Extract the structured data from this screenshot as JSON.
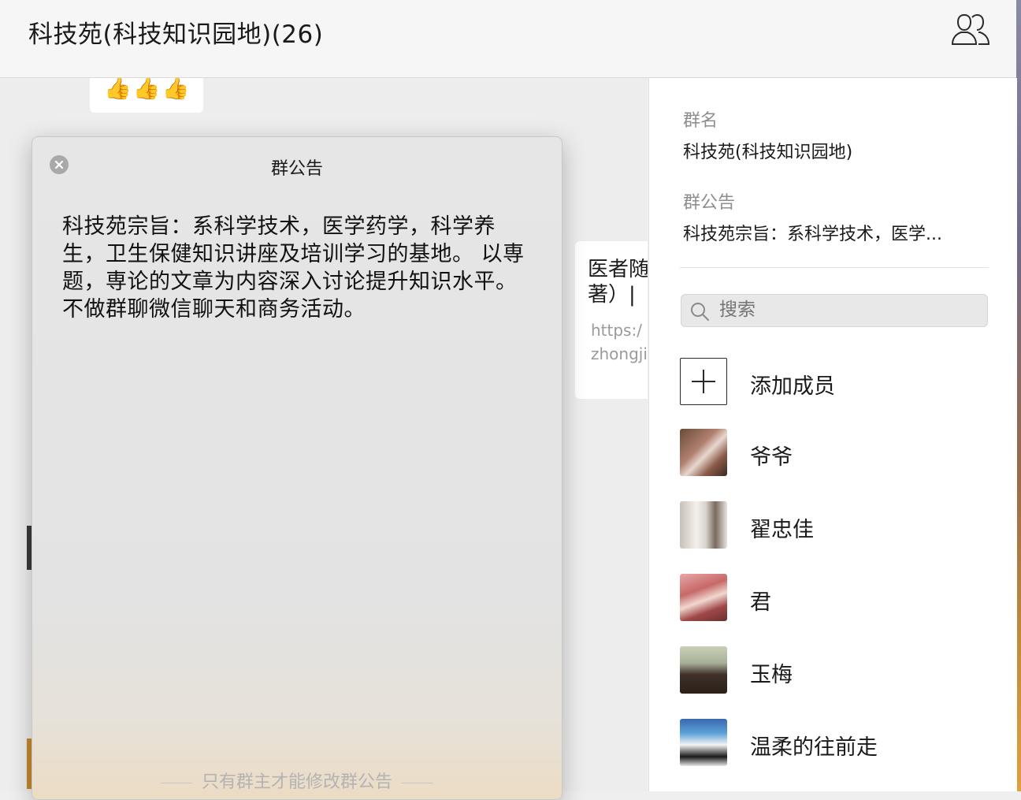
{
  "header": {
    "title": "科技苑(科技知识园地)(26)",
    "members_icon": "group-members-icon"
  },
  "chat": {
    "emoji_bubble": "👍👍👍",
    "link_card_title": "医者随\n著）|",
    "link_card_url": "https:/\nzhongji"
  },
  "announcement_modal": {
    "title": "群公告",
    "body": "科技苑宗旨：系科学技术，医学药学，科学养生，卫生保健知识讲座及培训学习的基地。 以専题，専论的文章为内容深入讨论提升知识水平。不做群聊微信聊天和商务活动。",
    "footer": "只有群主才能修改群公告",
    "close_icon": "close-icon"
  },
  "info_panel": {
    "group_name_label": "群名",
    "group_name": "科技苑(科技知识园地)",
    "announcement_label": "群公告",
    "announcement_preview": "科技苑宗旨：系科学技术，医学...",
    "search_placeholder": "搜索",
    "add_member_label": "添加成员",
    "members": [
      {
        "name": "爷爷"
      },
      {
        "name": "翟忠佳"
      },
      {
        "name": "君"
      },
      {
        "name": "玉梅"
      },
      {
        "name": "温柔的往前走"
      }
    ]
  },
  "colors": {
    "header_bg": "#f6f6f6",
    "chat_bg": "#ededed",
    "modal_bg": "#e6e6e6",
    "panel_bg": "#ffffff"
  }
}
